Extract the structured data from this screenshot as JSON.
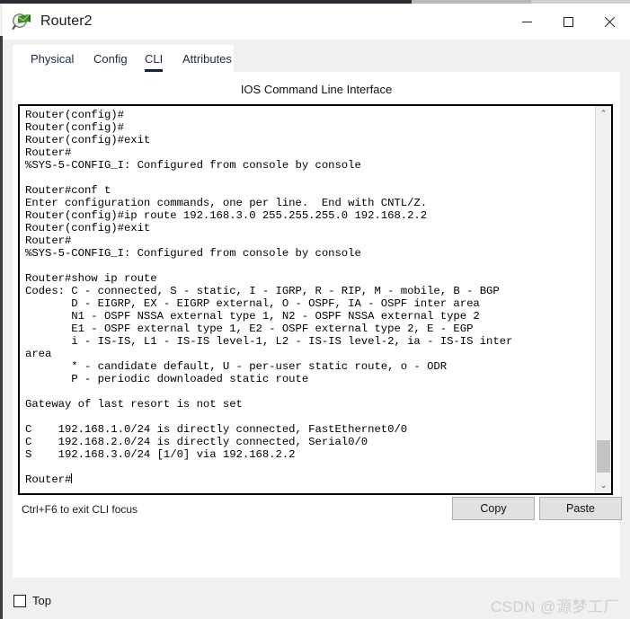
{
  "window": {
    "title": "Router2",
    "icon": "packet-tracer-magnifier-icon",
    "controls": {
      "minimize": "—",
      "maximize": "□",
      "close": "✕"
    }
  },
  "tabs": [
    {
      "label": "Physical",
      "active": false
    },
    {
      "label": "Config",
      "active": false
    },
    {
      "label": "CLI",
      "active": true
    },
    {
      "label": "Attributes",
      "active": false
    }
  ],
  "panel": {
    "header": "IOS Command Line Interface"
  },
  "terminal": {
    "lines": [
      "Router(config)#",
      "Router(config)#",
      "Router(config)#exit",
      "Router#",
      "%SYS-5-CONFIG_I: Configured from console by console",
      "",
      "Router#conf t",
      "Enter configuration commands, one per line.  End with CNTL/Z.",
      "Router(config)#ip route 192.168.3.0 255.255.255.0 192.168.2.2",
      "Router(config)#exit",
      "Router#",
      "%SYS-5-CONFIG_I: Configured from console by console",
      "",
      "Router#show ip route",
      "Codes: C - connected, S - static, I - IGRP, R - RIP, M - mobile, B - BGP",
      "       D - EIGRP, EX - EIGRP external, O - OSPF, IA - OSPF inter area",
      "       N1 - OSPF NSSA external type 1, N2 - OSPF NSSA external type 2",
      "       E1 - OSPF external type 1, E2 - OSPF external type 2, E - EGP",
      "       i - IS-IS, L1 - IS-IS level-1, L2 - IS-IS level-2, ia - IS-IS inter",
      "area",
      "       * - candidate default, U - per-user static route, o - ODR",
      "       P - periodic downloaded static route",
      "",
      "Gateway of last resort is not set",
      "",
      "C    192.168.1.0/24 is directly connected, FastEthernet0/0",
      "C    192.168.2.0/24 is directly connected, Serial0/0",
      "S    192.168.3.0/24 [1/0] via 192.168.2.2",
      ""
    ],
    "prompt": "Router#"
  },
  "scrollbar": {
    "up_glyph": "⌃",
    "down_glyph": "⌄"
  },
  "footer": {
    "hint": "Ctrl+F6 to exit CLI focus",
    "copy_label": "Copy",
    "paste_label": "Paste"
  },
  "bottom": {
    "top_checkbox_label": "Top",
    "top_checked": false,
    "watermark": "CSDN @源梦工厂"
  },
  "colors": {
    "accent": "#14243f",
    "tab_text": "#1b2a47",
    "panel_bg": "#ffffff",
    "window_bg": "#f0f0f0",
    "terminal_text": "#000000",
    "button_bg": "#e1e1e1",
    "watermark": "#cfcfcf"
  }
}
